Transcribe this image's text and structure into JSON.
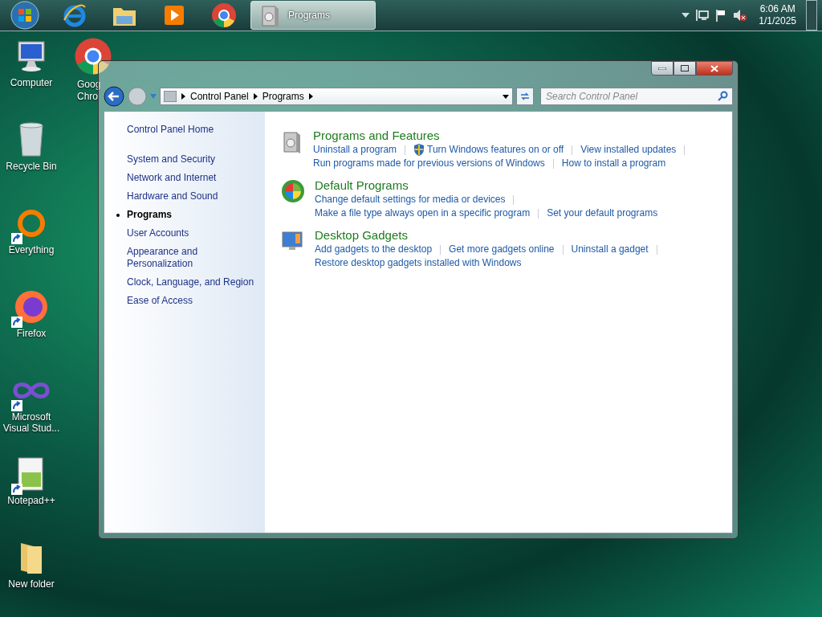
{
  "taskbar": {
    "window_buttons": [
      {
        "label": "Programs",
        "selected": true
      }
    ],
    "clock": {
      "time": "6:06 AM",
      "date": "1/1/2025"
    }
  },
  "desktop_icons": [
    {
      "label": "Computer",
      "shortcut": false
    },
    {
      "label": "Recycle Bin",
      "shortcut": false
    },
    {
      "label": "Everything",
      "shortcut": true
    },
    {
      "label": "Firefox",
      "shortcut": true
    },
    {
      "label": "Microsoft Visual Stud...",
      "shortcut": true
    },
    {
      "label": "Notepad++",
      "shortcut": true
    },
    {
      "label": "New folder",
      "shortcut": false
    }
  ],
  "partial_icon": {
    "label_lines": [
      "Goog",
      "Chro"
    ]
  },
  "window": {
    "breadcrumbs": [
      "Control Panel",
      "Programs"
    ],
    "search": {
      "placeholder": "Search Control Panel"
    },
    "sidebar": {
      "home": "Control Panel Home",
      "items": [
        {
          "label": "System and Security",
          "selected": false
        },
        {
          "label": "Network and Internet",
          "selected": false
        },
        {
          "label": "Hardware and Sound",
          "selected": false
        },
        {
          "label": "Programs",
          "selected": true
        },
        {
          "label": "User Accounts",
          "selected": false
        },
        {
          "label": "Appearance and Personalization",
          "selected": false
        },
        {
          "label": "Clock, Language, and Region",
          "selected": false
        },
        {
          "label": "Ease of Access",
          "selected": false
        }
      ]
    },
    "sections": [
      {
        "title": "Programs and Features",
        "kind": "programs",
        "lines": [
          [
            {
              "text": "Uninstall a program",
              "shield": false
            },
            {
              "text": "Turn Windows features on or off",
              "shield": true
            },
            {
              "text": "View installed updates",
              "shield": false
            }
          ],
          [
            {
              "text": "Run programs made for previous versions of Windows",
              "shield": false
            },
            {
              "text": "How to install a program",
              "shield": false
            }
          ]
        ]
      },
      {
        "title": "Default Programs",
        "kind": "defaults",
        "lines": [
          [
            {
              "text": "Change default settings for media or devices",
              "shield": false
            }
          ],
          [
            {
              "text": "Make a file type always open in a specific program",
              "shield": false
            },
            {
              "text": "Set your default programs",
              "shield": false
            }
          ]
        ]
      },
      {
        "title": "Desktop Gadgets",
        "kind": "gadgets",
        "lines": [
          [
            {
              "text": "Add gadgets to the desktop",
              "shield": false
            },
            {
              "text": "Get more gadgets online",
              "shield": false
            },
            {
              "text": "Uninstall a gadget",
              "shield": false
            }
          ],
          [
            {
              "text": "Restore desktop gadgets installed with Windows",
              "shield": false
            }
          ]
        ]
      }
    ]
  }
}
